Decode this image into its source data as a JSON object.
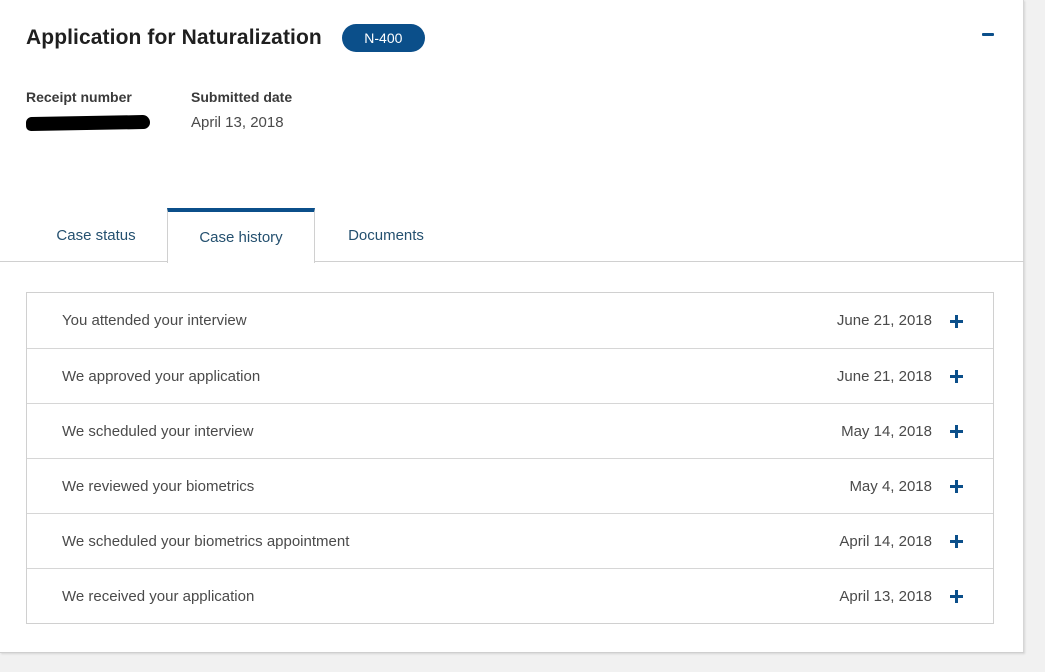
{
  "case": {
    "title": "Application for Naturalization",
    "form_badge": "N-400",
    "receipt_label": "Receipt number",
    "submitted_label": "Submitted date",
    "submitted_value": "April 13, 2018"
  },
  "tabs": [
    {
      "label": "Case status",
      "active": false
    },
    {
      "label": "Case history",
      "active": true
    },
    {
      "label": "Documents",
      "active": false
    }
  ],
  "history": [
    {
      "text": "You attended your interview",
      "date": "June 21, 2018"
    },
    {
      "text": "We approved your application",
      "date": "June 21, 2018"
    },
    {
      "text": "We scheduled your interview",
      "date": "May 14, 2018"
    },
    {
      "text": "We reviewed your biometrics",
      "date": "May 4, 2018"
    },
    {
      "text": "We scheduled your biometrics appointment",
      "date": "April 14, 2018"
    },
    {
      "text": "We received your application",
      "date": "April 13, 2018"
    }
  ],
  "colors": {
    "accent": "#0b4f8a",
    "tab_text": "#24506f",
    "border": "#d0d0d0"
  },
  "icons": {
    "collapse": "minus-icon",
    "expand": "plus-icon"
  }
}
